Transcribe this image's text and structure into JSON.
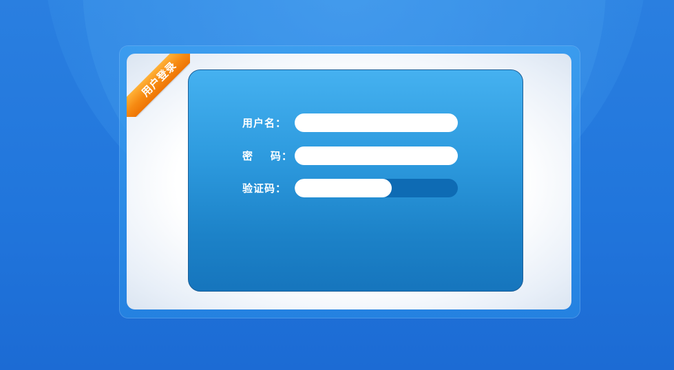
{
  "ribbon": {
    "label": "用户登录"
  },
  "form": {
    "username": {
      "label": "用户名：",
      "value": "",
      "placeholder": ""
    },
    "password": {
      "label": "密    码：",
      "value": "",
      "placeholder": ""
    },
    "captcha": {
      "label": "验证码：",
      "value": "",
      "placeholder": ""
    }
  },
  "colors": {
    "background": "#2176dc",
    "panel": "#ffffff",
    "form_box_top": "#45b1f0",
    "form_box_bottom": "#1675bd",
    "ribbon": "#f68a12",
    "captcha_track": "#0e6bb4"
  }
}
